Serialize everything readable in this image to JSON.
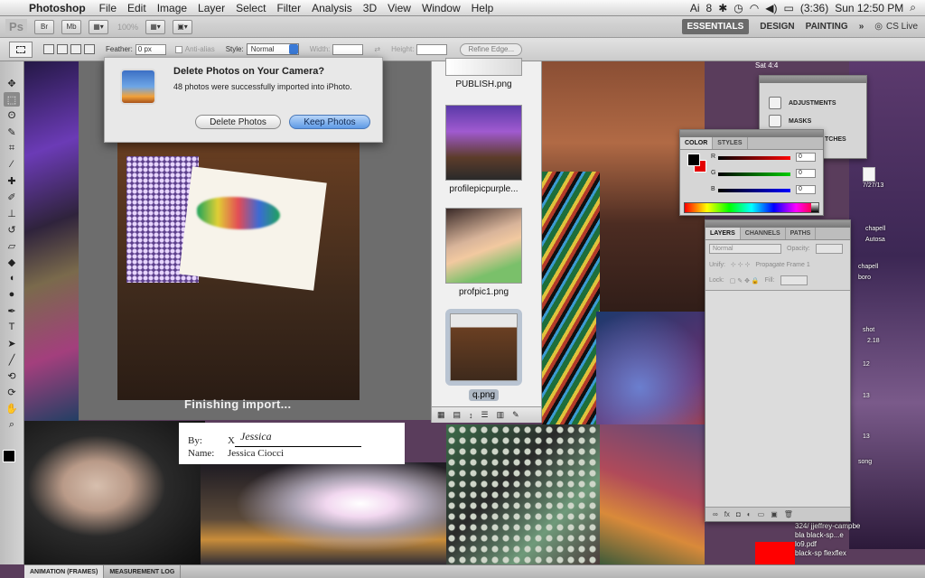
{
  "menubar": {
    "app_name": "Photoshop",
    "items": [
      "File",
      "Edit",
      "Image",
      "Layer",
      "Select",
      "Filter",
      "Analysis",
      "3D",
      "View",
      "Window",
      "Help"
    ],
    "status": {
      "adobe_badge": "8",
      "battery": "(3:36)",
      "clock": "Sun 12:50 PM"
    }
  },
  "appbar": {
    "logo": "Ps",
    "bridge": "Br",
    "minibridge": "Mb",
    "zoom": "100%",
    "workspaces": [
      "ESSENTIALS",
      "DESIGN",
      "PAINTING"
    ],
    "more": "»",
    "cs_live": "CS Live"
  },
  "options": {
    "feather_label": "Feather:",
    "feather_value": "0 px",
    "antialias_label": "Anti-alias",
    "style_label": "Style:",
    "style_value": "Normal",
    "width_label": "Width:",
    "height_label": "Height:",
    "refine_edge": "Refine Edge..."
  },
  "dialog": {
    "title": "Delete Photos on Your Camera?",
    "message": "48 photos were successfully imported into iPhoto.",
    "delete_label": "Delete Photos",
    "keep_label": "Keep Photos"
  },
  "preview": {
    "caption": "Finishing import..."
  },
  "browser": {
    "items": [
      {
        "name": "PUBLISH.png"
      },
      {
        "name": "profilepicpurple..."
      },
      {
        "name": "profpic1.png"
      },
      {
        "name": "q.png",
        "selected": true
      }
    ]
  },
  "signature": {
    "by_label": "By:",
    "x_label": "X",
    "signed": "Jessica",
    "name_label": "Name:",
    "name_value": "Jessica Ciocci"
  },
  "panels": {
    "adjustments": {
      "items": [
        "ADJUSTMENTS",
        "MASKS"
      ],
      "partial": "TCHES"
    },
    "color": {
      "tabs": [
        "COLOR",
        "STYLES"
      ],
      "r_label": "R",
      "g_label": "G",
      "b_label": "B",
      "r": "0",
      "g": "0",
      "b": "0",
      "foreground": "#000000",
      "background": "#e30000"
    },
    "layers": {
      "tabs": [
        "LAYERS",
        "CHANNELS",
        "PATHS"
      ],
      "blend_mode": "Normal",
      "opacity_label": "Opacity:",
      "unify_label": "Unify:",
      "propagate_label": "Propagate Frame 1",
      "lock_label": "Lock:",
      "fill_label": "Fill:"
    }
  },
  "dock": {
    "tabs": [
      "ANIMATION (FRAMES)",
      "MEASUREMENT LOG"
    ]
  },
  "desktop": {
    "date_fragment": "Sat 4:4",
    "date_label": "7/27/13",
    "labels": [
      "chapell",
      "Autosa",
      "chapell",
      "boro",
      "shot",
      "2.18",
      "12",
      "13",
      "song",
      "13"
    ],
    "bottom_labels": [
      "324/ jjeffrey-campbe",
      "bla  black-sp...e",
      "lo9.pdf",
      "black-sp  flexflex"
    ]
  }
}
